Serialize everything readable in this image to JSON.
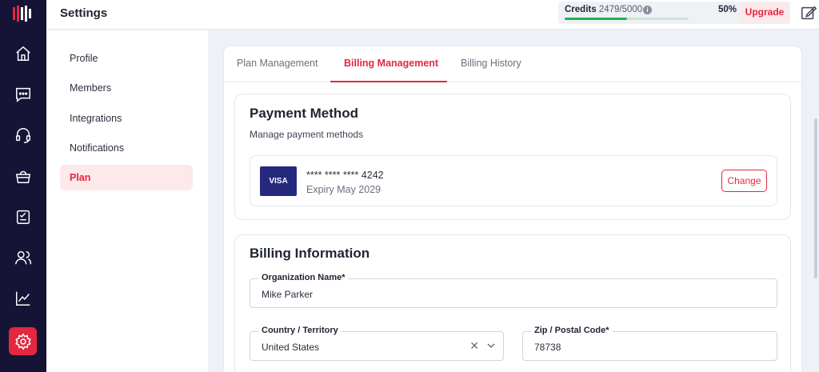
{
  "topbar": {
    "title": "Settings",
    "credits_label": "Credits",
    "credits_value": "2479/5000",
    "credits_percent": "50%",
    "credits_used_fraction": 0.5,
    "upgrade_label": "Upgrade"
  },
  "settings_nav": {
    "items": [
      {
        "label": "Profile"
      },
      {
        "label": "Members"
      },
      {
        "label": "Integrations"
      },
      {
        "label": "Notifications"
      },
      {
        "label": "Plan"
      }
    ],
    "active": "Plan"
  },
  "tabs": {
    "items": [
      {
        "label": "Plan Management"
      },
      {
        "label": "Billing Management"
      },
      {
        "label": "Billing History"
      }
    ],
    "active": "Billing Management"
  },
  "payment": {
    "title": "Payment Method",
    "subtitle": "Manage payment methods",
    "card_brand": "VISA",
    "card_number": "**** **** **** 4242",
    "expiry": "Expiry May 2029",
    "change_label": "Change"
  },
  "billing": {
    "title": "Billing Information",
    "org_label": "Organization Name*",
    "org_value": "Mike Parker",
    "country_label": "Country / Territory",
    "country_value": "United States",
    "zip_label": "Zip / Postal Code*",
    "zip_value": "78738"
  },
  "colors": {
    "accent": "#e4273f",
    "rail": "#151437",
    "progress": "#22b14c",
    "visa": "#24297e"
  },
  "icons": {
    "rail": [
      "home-icon",
      "chat-icon",
      "headset-icon",
      "basket-icon",
      "tasks-icon",
      "users-icon",
      "chart-icon",
      "settings-icon"
    ],
    "topbar": [
      "info-icon",
      "edit-icon",
      "avatar"
    ]
  }
}
